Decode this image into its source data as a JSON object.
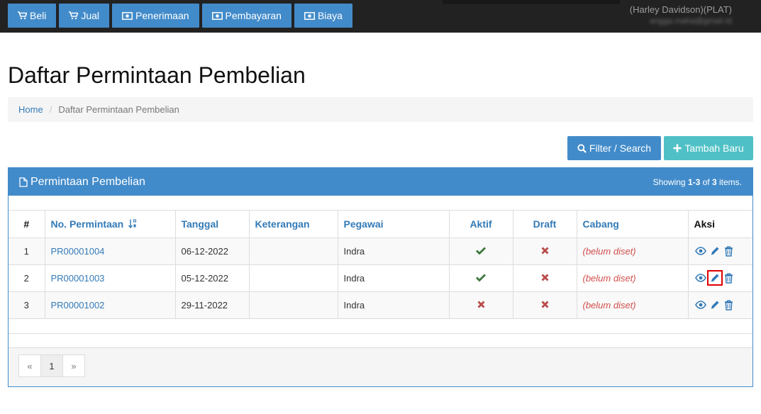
{
  "nav": {
    "items": [
      {
        "label": "Beli",
        "icon": "cart-icon"
      },
      {
        "label": "Jual",
        "icon": "cart-icon"
      },
      {
        "label": "Penerimaan",
        "icon": "money-icon"
      },
      {
        "label": "Pembayaran",
        "icon": "money-icon"
      },
      {
        "label": "Biaya",
        "icon": "money-icon"
      }
    ],
    "user_name": "(Harley Davidson)(PLAT)",
    "user_email": "angga.maha@gmail.id"
  },
  "page": {
    "title": "Daftar Permintaan Pembelian"
  },
  "breadcrumb": {
    "home": "Home",
    "separator": "/",
    "current": "Daftar Permintaan Pembelian"
  },
  "actions": {
    "filter_label": "Filter / Search",
    "add_label": "Tambah Baru"
  },
  "panel": {
    "title": "Permintaan Pembelian",
    "summary_prefix": "Showing ",
    "summary_range": "1-3",
    "summary_of": " of ",
    "summary_total": "3",
    "summary_suffix": " items."
  },
  "table": {
    "columns": [
      "#",
      "No. Permintaan",
      "Tanggal",
      "Keterangan",
      "Pegawai",
      "Aktif",
      "Draft",
      "Cabang",
      "Aksi"
    ],
    "rows": [
      {
        "num": "1",
        "no": "PR00001004",
        "tanggal": "06-12-2022",
        "keterangan": "",
        "pegawai": "Indra",
        "aktif": true,
        "draft": false,
        "cabang": "(belum diset)"
      },
      {
        "num": "2",
        "no": "PR00001003",
        "tanggal": "05-12-2022",
        "keterangan": "",
        "pegawai": "Indra",
        "aktif": true,
        "draft": false,
        "cabang": "(belum diset)"
      },
      {
        "num": "3",
        "no": "PR00001002",
        "tanggal": "29-11-2022",
        "keterangan": "",
        "pegawai": "Indra",
        "aktif": false,
        "draft": false,
        "cabang": "(belum diset)"
      }
    ]
  },
  "pagination": {
    "prev": "«",
    "current": "1",
    "next": "»"
  },
  "colors": {
    "primary": "#428bca",
    "success": "#3c763d",
    "danger": "#c9302c",
    "highlight": "#e00000"
  }
}
